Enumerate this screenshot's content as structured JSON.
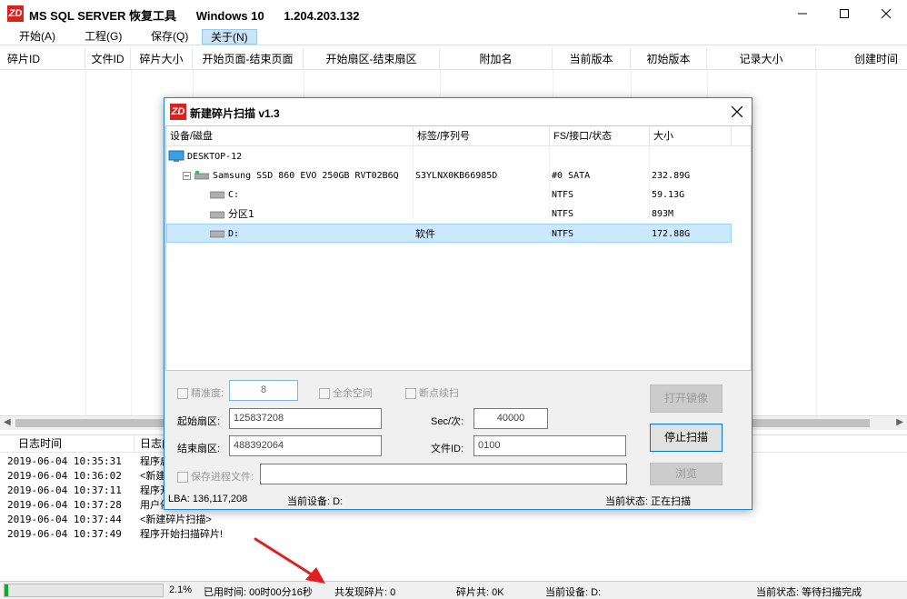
{
  "window": {
    "logo": "ZD",
    "title_app": "MS SQL SERVER 恢复工具",
    "title_os": "Windows 10",
    "title_version": "1.204.203.132",
    "controls": [
      "minimize-icon",
      "maximize-icon",
      "close-icon"
    ]
  },
  "menu": [
    {
      "label": "开始(A)"
    },
    {
      "label": "工程(G)"
    },
    {
      "label": "保存(Q)"
    },
    {
      "label": "关于(N)"
    }
  ],
  "grid": {
    "columns": [
      "碎片ID",
      "文件ID",
      "碎片大小",
      "开始页面-结束页面",
      "开始扇区-结束扇区",
      "附加名",
      "当前版本",
      "初始版本",
      "记录大小",
      "创建时间"
    ]
  },
  "log": {
    "columns": [
      "日志时间",
      "日志内容"
    ],
    "rows": [
      {
        "time": "2019-06-04 10:35:31",
        "msg": "程序启动"
      },
      {
        "time": "2019-06-04 10:36:02",
        "msg": "<新建碎片扫描>"
      },
      {
        "time": "2019-06-04 10:37:11",
        "msg": "程序开始扫描碎片!"
      },
      {
        "time": "2019-06-04 10:37:28",
        "msg": "用户停止扫描碎片"
      },
      {
        "time": "2019-06-04 10:37:44",
        "msg": "<新建碎片扫描>"
      },
      {
        "time": "2019-06-04 10:37:49",
        "msg": "程序开始扫描碎片!"
      }
    ]
  },
  "statusbar": {
    "progress_fraction": 0.021,
    "percent": "2.1%",
    "elapsed": "已用时间: 00时00分16秒",
    "found": "共发现碎片: 0",
    "fragments": "碎片共: 0K",
    "device": "当前设备: D:",
    "state": "当前状态: 等待扫描完成"
  },
  "dialog": {
    "logo": "ZD",
    "title": "新建碎片扫描 v1.3",
    "tree_columns": [
      "设备/磁盘",
      "标签/序列号",
      "FS/接口/状态",
      "大小"
    ],
    "tree_rows": [
      {
        "name": "DESKTOP-12",
        "label": "",
        "fs": "",
        "size": ""
      },
      {
        "name": "Samsung SSD 860 EVO 250GB RVT02B6Q",
        "label": "S3YLNX0KB66985D",
        "fs": "#0 SATA",
        "size": "232.89G"
      },
      {
        "name": "C:",
        "label": "",
        "fs": "NTFS",
        "size": "59.13G"
      },
      {
        "name": "分区1",
        "label": "",
        "fs": "NTFS",
        "size": "893M"
      },
      {
        "name": "D:",
        "label": "软件",
        "fs": "NTFS",
        "size": "172.88G"
      }
    ],
    "precision_label": "精准度:",
    "precision_value": "8",
    "full_space_label": "全余空间",
    "resume_label": "断点续扫",
    "start_sector_label": "起始扇区:",
    "start_sector_value": "125837208",
    "end_sector_label": "结束扇区:",
    "end_sector_value": "488392064",
    "sec_label": "Sec/次:",
    "sec_value": "40000",
    "file_id_label": "文件ID:",
    "file_id_value": "0100",
    "save_progress_label": "保存进程文件:",
    "save_progress_value": "",
    "btn_open_image": "打开镜像",
    "btn_stop_scan": "停止扫描",
    "btn_browse": "浏览",
    "lba": "LBA: 136,117,208",
    "current_device": "当前设备: D:",
    "current_state": "当前状态: 正在扫描"
  },
  "colors": {
    "logo_red": "#d9231f",
    "progress_green": "#06b025",
    "selection": "#cce8ff",
    "annotation_arrow": "#e02020"
  }
}
